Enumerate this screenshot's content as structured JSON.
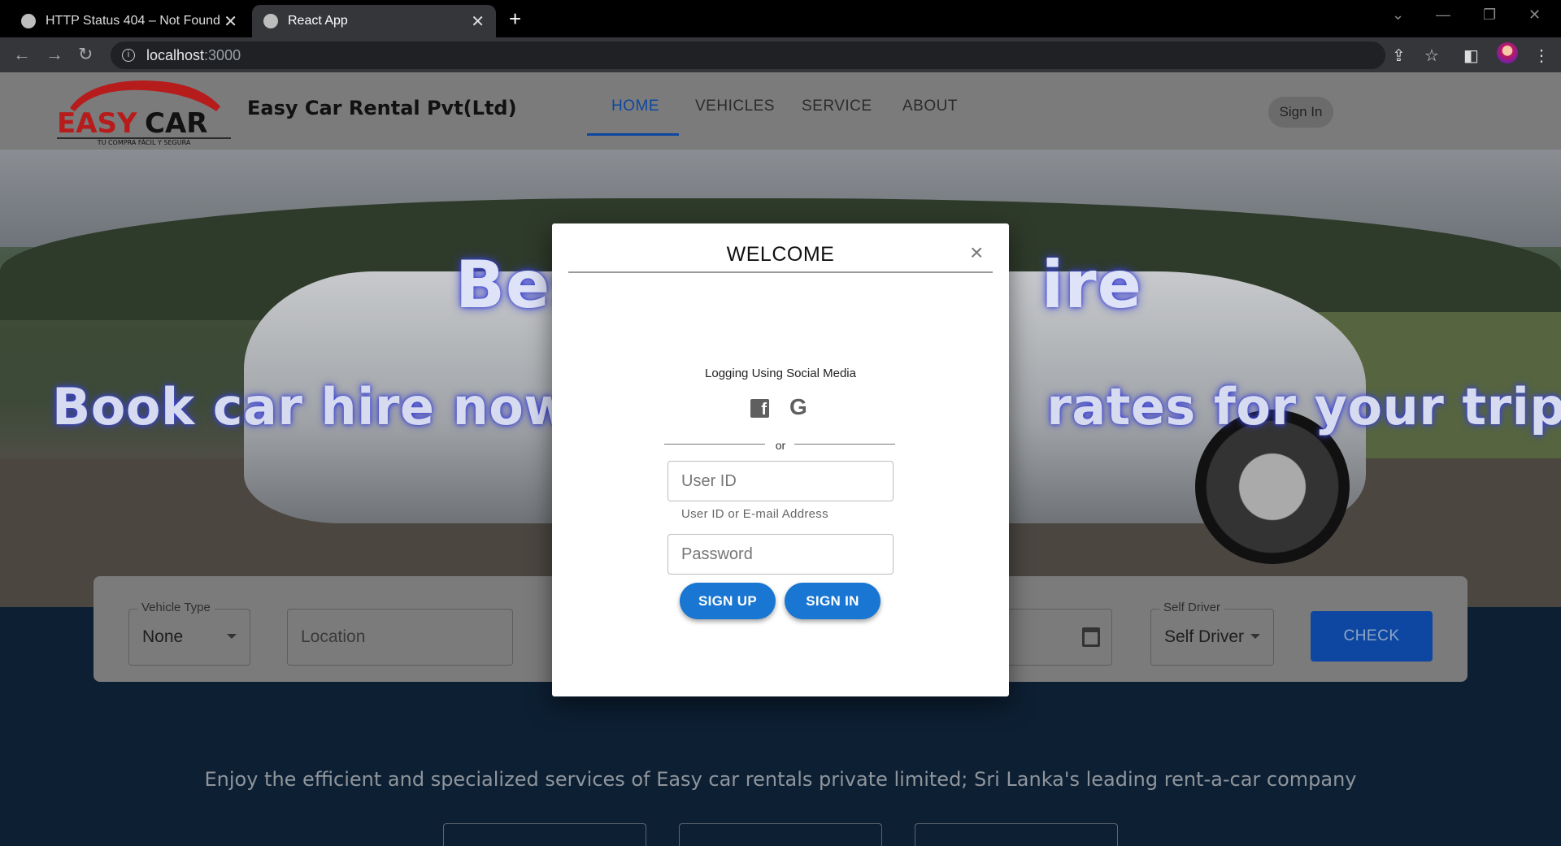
{
  "browser": {
    "tabs": [
      {
        "title": "HTTP Status 404 – Not Found"
      },
      {
        "title": "React App"
      }
    ],
    "url_host": "localhost",
    "url_port": ":3000"
  },
  "header": {
    "logo_text": "EASY CAR",
    "logo_tagline": "TU COMPRA FÁCIL Y SEGURA",
    "brand": "Easy Car Rental Pvt(Ltd)",
    "nav": [
      "HOME",
      "VEHICLES",
      "SERVICE",
      "ABOUT"
    ],
    "active_nav": "HOME",
    "signin": "Sign In"
  },
  "hero": {
    "title_left": "Bes",
    "title_right": "ire",
    "subtitle_left": "Book car hire now o",
    "subtitle_right": "rates for your trip!"
  },
  "search": {
    "vehicle_type_label": "Vehicle Type",
    "vehicle_type_value": "None",
    "location_placeholder": "Location",
    "driver_label": "Self Driver",
    "driver_value": "Self Driver",
    "check_label": "CHECK"
  },
  "tagline": "Enjoy the efficient and specialized services of Easy car rentals private limited; Sri Lanka's leading rent-a-car company",
  "modal": {
    "title": "WELCOME",
    "close": "×",
    "social_caption": "Logging Using Social Media",
    "or": "or",
    "userid_placeholder": "User ID",
    "userid_helper": "User ID or E-mail Address",
    "password_placeholder": "Password",
    "signup_label": "SIGN UP",
    "signin_label": "SIGN IN"
  },
  "colors": {
    "primary": "#1976d2",
    "nav_active": "#0d47a1",
    "hero_glow": "#3b43d6"
  }
}
